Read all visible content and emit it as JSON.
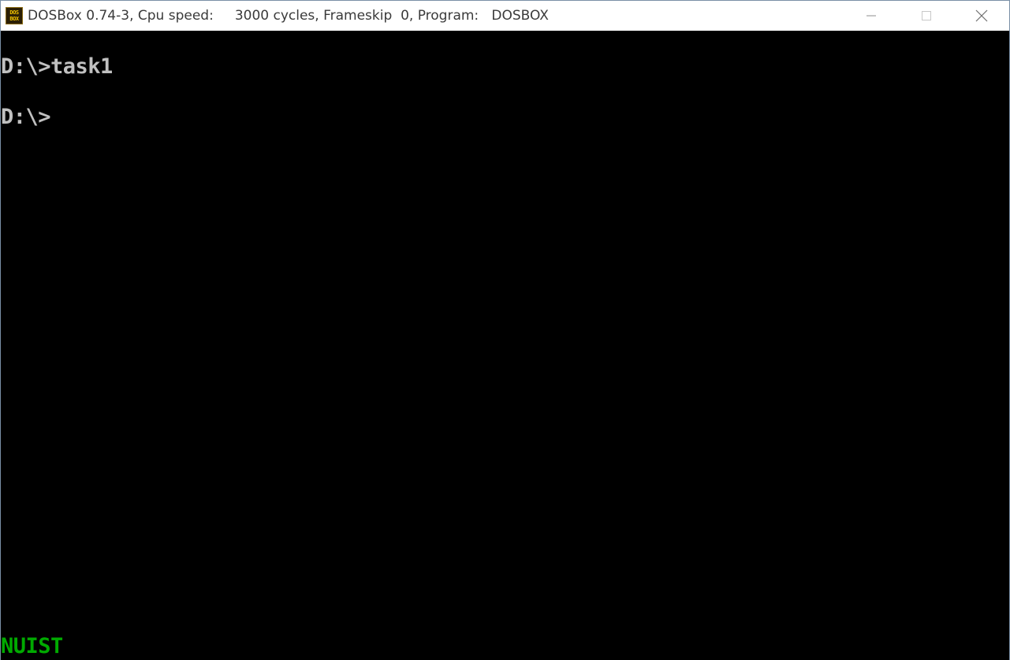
{
  "window": {
    "title": "DOSBox 0.74-3, Cpu speed:     3000 cycles, Frameskip  0, Program:   DOSBOX",
    "app_icon_top": "DOS",
    "app_icon_bottom": "BOX",
    "icons": {
      "app": "dosbox-icon",
      "minimize": "minimize-icon",
      "maximize": "maximize-icon",
      "close": "close-icon"
    }
  },
  "console": {
    "lines": [
      "D:\\>task1",
      "D:\\>"
    ],
    "status_text": "NUIST"
  },
  "colors": {
    "screen_background": "#000000",
    "console_text": "#c0c0c0",
    "status_text": "#00aa00",
    "titlebar_background": "#ffffff"
  }
}
